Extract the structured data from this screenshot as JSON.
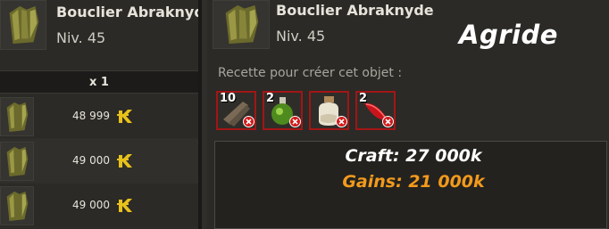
{
  "item": {
    "name": "Bouclier Abraknyde",
    "level": "Niv. 45",
    "icon": "abraknyde-shield-icon"
  },
  "market": {
    "quantity_label": "x 1",
    "currency_icon": "kama-icon",
    "offers": [
      {
        "price": "48 999"
      },
      {
        "price": "49 000"
      },
      {
        "price": "49 000"
      }
    ]
  },
  "server_name": "Agride",
  "recipe": {
    "label": "Recette pour créer cet objet :",
    "ingredients": [
      {
        "count": "10",
        "icon": "wood-plank-icon",
        "missing": true
      },
      {
        "count": "2",
        "icon": "green-potion-icon",
        "missing": true
      },
      {
        "count": "",
        "icon": "powder-jar-icon",
        "missing": true
      },
      {
        "count": "2",
        "icon": "red-feather-icon",
        "missing": true
      }
    ]
  },
  "summary": {
    "craft": "Craft: 27 000k",
    "gains": "Gains: 21 000k"
  },
  "colors": {
    "gains": "#f29a1c",
    "missing_border": "#a31515",
    "background": "#2b2a26"
  }
}
